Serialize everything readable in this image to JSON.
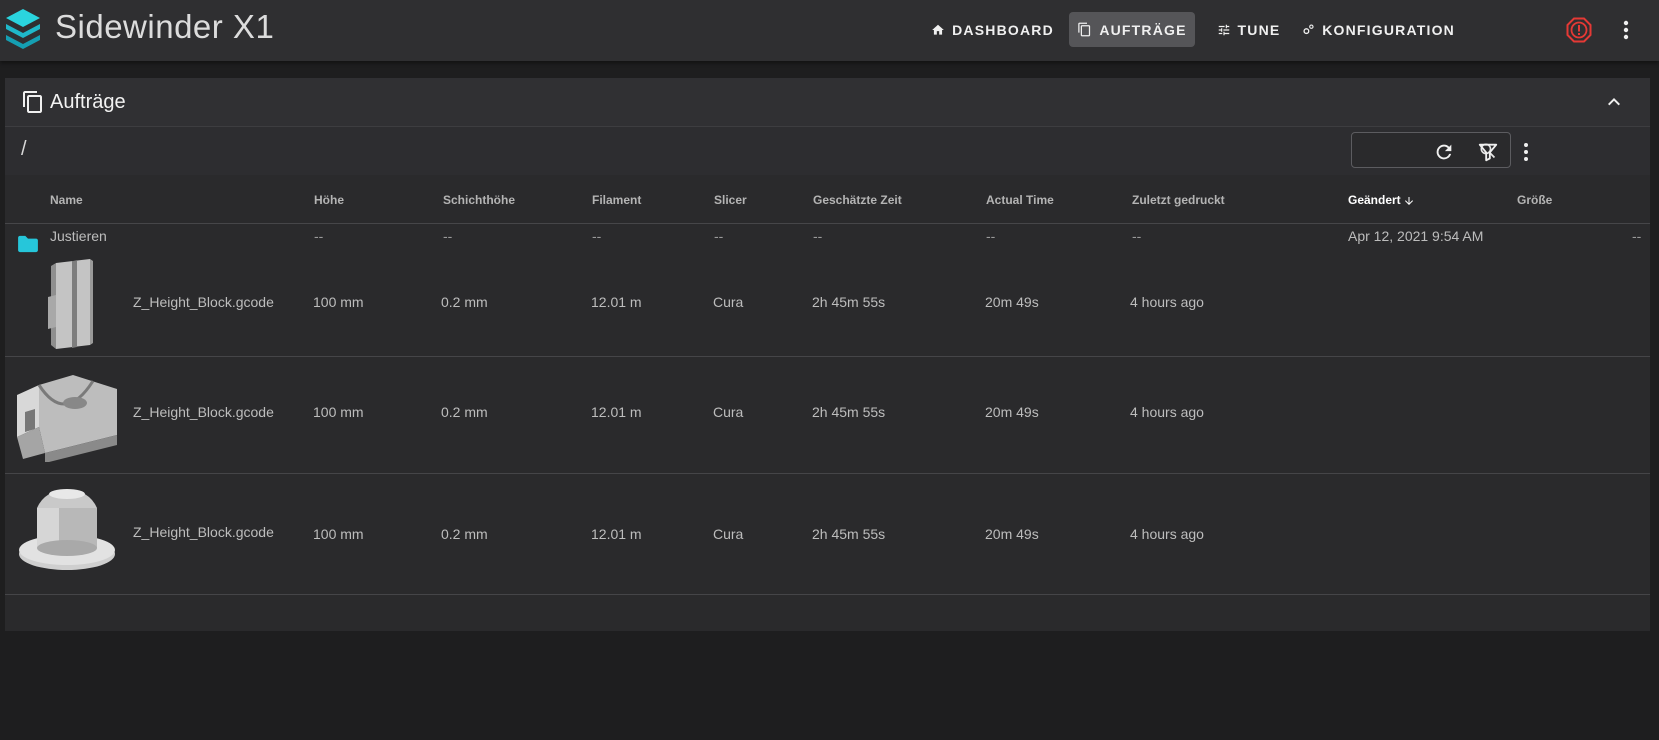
{
  "app": {
    "title": "Sidewinder X1",
    "nav": [
      {
        "label": "DASHBOARD",
        "icon": "home-icon",
        "active": false
      },
      {
        "label": "AUFTRÄGE",
        "icon": "file-copy-icon",
        "active": true
      },
      {
        "label": "TUNE",
        "icon": "tune-icon",
        "active": false
      },
      {
        "label": "KONFIGURATION",
        "icon": "cogs-icon",
        "active": false
      }
    ],
    "estop_icon": "emergency-stop-icon",
    "menu_icon": "dots-vertical-icon"
  },
  "card": {
    "title": "Aufträge",
    "path": "/",
    "search": {
      "value": "",
      "placeholder": ""
    }
  },
  "table": {
    "columns": [
      "Name",
      "Höhe",
      "Schichthöhe",
      "Filament",
      "Slicer",
      "Geschätzte Zeit",
      "Actual Time",
      "Zuletzt gedruckt",
      "Geändert",
      "Größe"
    ],
    "sorted_column": "Geändert",
    "sort_direction": "descending",
    "folder": {
      "name": "Justieren",
      "hoehe": "--",
      "schicht": "--",
      "filament": "--",
      "slicer": "--",
      "geschaetzt": "--",
      "actual": "--",
      "zuletzt": "--",
      "geaendert": "Apr 12, 2021 9:54 AM",
      "groesse": "--"
    },
    "files": [
      {
        "thumb": "tall-block-thumbnail",
        "name": "Z_Height_Block.gcode",
        "hoehe": "100 mm",
        "schicht": "0.2 mm",
        "filament": "12.01 m",
        "slicer": "Cura",
        "geschaetzt": "2h 45m 55s",
        "actual": "20m 49s",
        "zuletzt": "4 hours ago"
      },
      {
        "thumb": "bracket-thumbnail",
        "name": "Z_Height_Block.gcode",
        "hoehe": "100 mm",
        "schicht": "0.2 mm",
        "filament": "12.01 m",
        "slicer": "Cura",
        "geschaetzt": "2h 45m 55s",
        "actual": "20m 49s",
        "zuletzt": "4 hours ago"
      },
      {
        "thumb": "cylinder-thumbnail",
        "name": "Z_Height_Block.gcode",
        "hoehe": "100 mm",
        "schicht": "0.2 mm",
        "filament": "12.01 m",
        "slicer": "Cura",
        "geschaetzt": "2h 45m 55s",
        "actual": "20m 49s",
        "zuletzt": "4 hours ago"
      }
    ]
  },
  "colors": {
    "accent": "#26c6da",
    "estop": "#e53935",
    "active_nav": "#555558"
  }
}
